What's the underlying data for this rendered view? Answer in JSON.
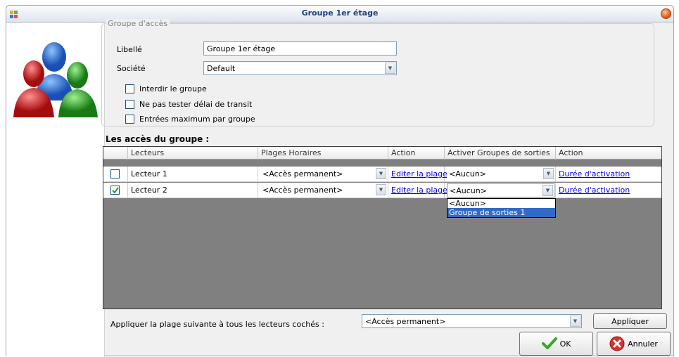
{
  "window": {
    "title": "Groupe 1er étage"
  },
  "group": {
    "legend": "Groupe d'accès",
    "libelle_label": "Libellé",
    "libelle_value": "Groupe 1er étage",
    "societe_label": "Société",
    "societe_value": "Default",
    "options": [
      {
        "label": "Interdir le groupe",
        "checked": false
      },
      {
        "label": "Ne pas tester délai de transit",
        "checked": false
      },
      {
        "label": "Entrées maximum par groupe",
        "checked": false
      }
    ]
  },
  "grid": {
    "title": "Les accès du groupe :",
    "columns": [
      "Lecteurs",
      "Plages Horaires",
      "Action",
      "Activer Groupes de sorties",
      "Action"
    ],
    "rows": [
      {
        "checked": false,
        "lecteur": "Lecteur 1",
        "plage": "<Accès permanent>",
        "action1": "Editer la plage",
        "groupe_sorties": "<Aucun>",
        "action2": "Durée d'activation"
      },
      {
        "checked": true,
        "lecteur": "Lecteur 2",
        "plage": "<Accès permanent>",
        "action1": "Editer la plage",
        "groupe_sorties": "<Aucun>",
        "action2": "Durée d'activation"
      }
    ],
    "dropdown_options": [
      "<Aucun>",
      "Groupe de sorties 1"
    ],
    "dropdown_selected_index": 1
  },
  "footer": {
    "apply_text": "Appliquer la plage suivante à tous les lecteurs cochés :",
    "apply_combo_value": "<Accès permanent>",
    "apply_button": "Appliquer",
    "ok_button": "OK",
    "cancel_button": "Annuler"
  },
  "colors": {
    "link": "#0000ee",
    "selection": "#3169c6",
    "grid_bg": "#808080"
  },
  "icons": [
    "window-app-icon",
    "close-icon",
    "users-group-icon",
    "checkmark-icon",
    "cancel-icon",
    "chevron-down-icon"
  ]
}
